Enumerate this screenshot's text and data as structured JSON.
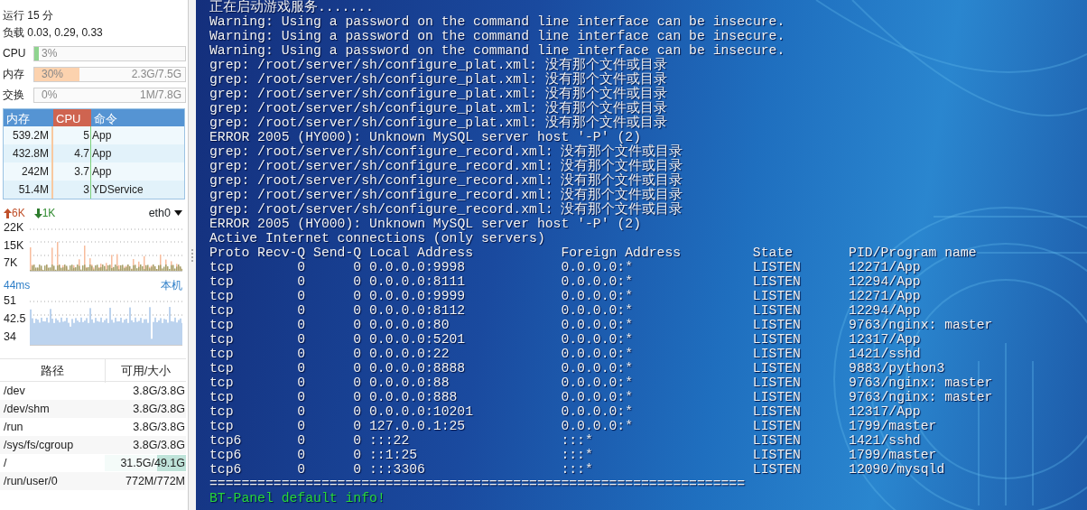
{
  "sidebar": {
    "uptime": "运行 15 分",
    "load": "负载 0.03, 0.29, 0.33",
    "meters": [
      {
        "label": "CPU",
        "level": 0.03,
        "percent": "3%",
        "kind": "cpu"
      },
      {
        "label": "内存",
        "level": 0.3,
        "percent": "30%",
        "detail": "2.3G/7.5G",
        "kind": "mem"
      },
      {
        "label": "交换",
        "percent": "0%",
        "detail": "1M/7.8G",
        "kind": "mem"
      }
    ],
    "process_table": {
      "columns": [
        {
          "label": "内存",
          "sorted": false
        },
        {
          "label": "CPU",
          "sorted": true
        },
        {
          "label": "命令",
          "sorted": false
        }
      ],
      "rows": [
        [
          "539.2M",
          "5",
          "App"
        ],
        [
          "432.8M",
          "4.7",
          "App"
        ],
        [
          "242M",
          "3.7",
          "App"
        ],
        [
          "51.4M",
          "3",
          "YDService"
        ]
      ]
    },
    "network": {
      "upload": "6K",
      "download": "1K",
      "interface": "eth0",
      "y_labels": [
        "22K",
        "15K",
        "7K"
      ]
    },
    "ping": {
      "latency": "44ms",
      "host": "本机",
      "y_labels": [
        "51",
        "42.5",
        "34"
      ]
    },
    "disk_table": {
      "columns": [
        "路径",
        "可用/大小"
      ],
      "rows": [
        {
          "path": "/dev",
          "size": "3.8G/3.8G"
        },
        {
          "path": "/dev/shm",
          "size": "3.8G/3.8G"
        },
        {
          "path": "/run",
          "size": "3.8G/3.8G"
        },
        {
          "path": "/sys/fs/cgroup",
          "size": "3.8G/3.8G"
        },
        {
          "path": "/",
          "size": "31.5G/49.1G",
          "level": 0.36
        },
        {
          "path": "/run/user/0",
          "size": "772M/772M"
        }
      ]
    }
  },
  "terminal": {
    "lines_before": [
      {
        "kind": "plain",
        "text": "正在启动游戏服务......."
      },
      {
        "kind": "plain",
        "text": "Warning: Using a password on the command line interface can be insecure."
      },
      {
        "kind": "plain",
        "text": "Warning: Using a password on the command line interface can be insecure."
      },
      {
        "kind": "plain",
        "text": "Warning: Using a password on the command line interface can be insecure."
      },
      {
        "kind": "plain",
        "text": "grep: /root/server/sh/configure_plat.xml: 没有那个文件或目录"
      },
      {
        "kind": "plain",
        "text": "grep: /root/server/sh/configure_plat.xml: 没有那个文件或目录"
      },
      {
        "kind": "plain",
        "text": "grep: /root/server/sh/configure_plat.xml: 没有那个文件或目录"
      },
      {
        "kind": "plain",
        "text": "grep: /root/server/sh/configure_plat.xml: 没有那个文件或目录"
      },
      {
        "kind": "plain",
        "text": "grep: /root/server/sh/configure_plat.xml: 没有那个文件或目录"
      },
      {
        "kind": "plain",
        "text": "ERROR 2005 (HY000): Unknown MySQL server host '-P' (2)"
      },
      {
        "kind": "plain",
        "text": "grep: /root/server/sh/configure_record.xml: 没有那个文件或目录"
      },
      {
        "kind": "plain",
        "text": "grep: /root/server/sh/configure_record.xml: 没有那个文件或目录"
      },
      {
        "kind": "plain",
        "text": "grep: /root/server/sh/configure_record.xml: 没有那个文件或目录"
      },
      {
        "kind": "plain",
        "text": "grep: /root/server/sh/configure_record.xml: 没有那个文件或目录"
      },
      {
        "kind": "plain",
        "text": "grep: /root/server/sh/configure_record.xml: 没有那个文件或目录"
      },
      {
        "kind": "plain",
        "text": "ERROR 2005 (HY000): Unknown MySQL server host '-P' (2)"
      },
      {
        "kind": "plain",
        "text": "Active Internet connections (only servers)"
      }
    ],
    "netstat": {
      "columns": [
        "Proto",
        "Recv-Q",
        "Send-Q",
        "Local Address",
        "Foreign Address",
        "State",
        "PID/Program name"
      ],
      "rows": [
        [
          "tcp",
          "0",
          "0",
          "0.0.0.0:9998",
          "0.0.0.0:*",
          "LISTEN",
          "12271/App"
        ],
        [
          "tcp",
          "0",
          "0",
          "0.0.0.0:8111",
          "0.0.0.0:*",
          "LISTEN",
          "12294/App"
        ],
        [
          "tcp",
          "0",
          "0",
          "0.0.0.0:9999",
          "0.0.0.0:*",
          "LISTEN",
          "12271/App"
        ],
        [
          "tcp",
          "0",
          "0",
          "0.0.0.0:8112",
          "0.0.0.0:*",
          "LISTEN",
          "12294/App"
        ],
        [
          "tcp",
          "0",
          "0",
          "0.0.0.0:80",
          "0.0.0.0:*",
          "LISTEN",
          "9763/nginx: master"
        ],
        [
          "tcp",
          "0",
          "0",
          "0.0.0.0:5201",
          "0.0.0.0:*",
          "LISTEN",
          "12317/App"
        ],
        [
          "tcp",
          "0",
          "0",
          "0.0.0.0:22",
          "0.0.0.0:*",
          "LISTEN",
          "1421/sshd"
        ],
        [
          "tcp",
          "0",
          "0",
          "0.0.0.0:8888",
          "0.0.0.0:*",
          "LISTEN",
          "9883/python3"
        ],
        [
          "tcp",
          "0",
          "0",
          "0.0.0.0:88",
          "0.0.0.0:*",
          "LISTEN",
          "9763/nginx: master"
        ],
        [
          "tcp",
          "0",
          "0",
          "0.0.0.0:888",
          "0.0.0.0:*",
          "LISTEN",
          "9763/nginx: master"
        ],
        [
          "tcp",
          "0",
          "0",
          "0.0.0.0:10201",
          "0.0.0.0:*",
          "LISTEN",
          "12317/App"
        ],
        [
          "tcp",
          "0",
          "0",
          "127.0.0.1:25",
          "0.0.0.0:*",
          "LISTEN",
          "1799/master"
        ],
        [
          "tcp6",
          "0",
          "0",
          ":::22",
          ":::*",
          "LISTEN",
          "1421/sshd"
        ],
        [
          "tcp6",
          "0",
          "0",
          "::1:25",
          ":::*",
          "LISTEN",
          "1799/master"
        ],
        [
          "tcp6",
          "0",
          "0",
          ":::3306",
          ":::*",
          "LISTEN",
          "12090/mysqld"
        ]
      ]
    },
    "lines_after": [
      {
        "kind": "plain",
        "text": "==================================================================="
      },
      {
        "kind": "highlight",
        "text": "BT-Panel default info!"
      }
    ]
  }
}
